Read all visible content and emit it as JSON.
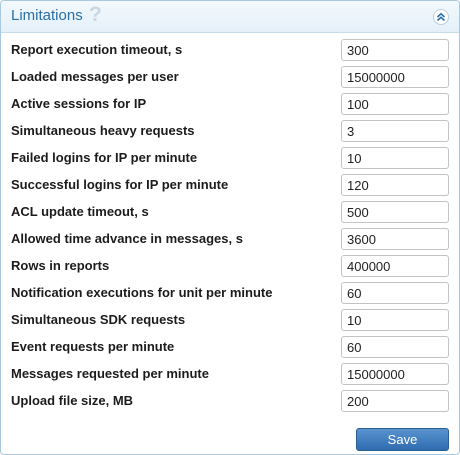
{
  "panel": {
    "title": "Limitations",
    "help_glyph": "?",
    "help_icon": "question-mark-icon",
    "collapse_icon": "double-chevron-up-icon",
    "accent_color": "#2a6fa6"
  },
  "rows": [
    {
      "label": "Report execution timeout, s",
      "value": "300"
    },
    {
      "label": "Loaded messages per user",
      "value": "15000000"
    },
    {
      "label": "Active sessions for IP",
      "value": "100"
    },
    {
      "label": "Simultaneous heavy requests",
      "value": "3"
    },
    {
      "label": "Failed logins for IP per minute",
      "value": "10"
    },
    {
      "label": "Successful logins for IP per minute",
      "value": "120"
    },
    {
      "label": "ACL update timeout, s",
      "value": "500"
    },
    {
      "label": "Allowed time advance in messages, s",
      "value": "3600"
    },
    {
      "label": "Rows in reports",
      "value": "400000"
    },
    {
      "label": "Notification executions for unit per minute",
      "value": "60"
    },
    {
      "label": "Simultaneous SDK requests",
      "value": "10"
    },
    {
      "label": "Event requests per minute",
      "value": "60"
    },
    {
      "label": "Messages requested per minute",
      "value": "15000000"
    },
    {
      "label": "Upload file size, MB",
      "value": "200"
    }
  ],
  "actions": {
    "save_label": "Save",
    "save_color": "#2e6bb0"
  }
}
